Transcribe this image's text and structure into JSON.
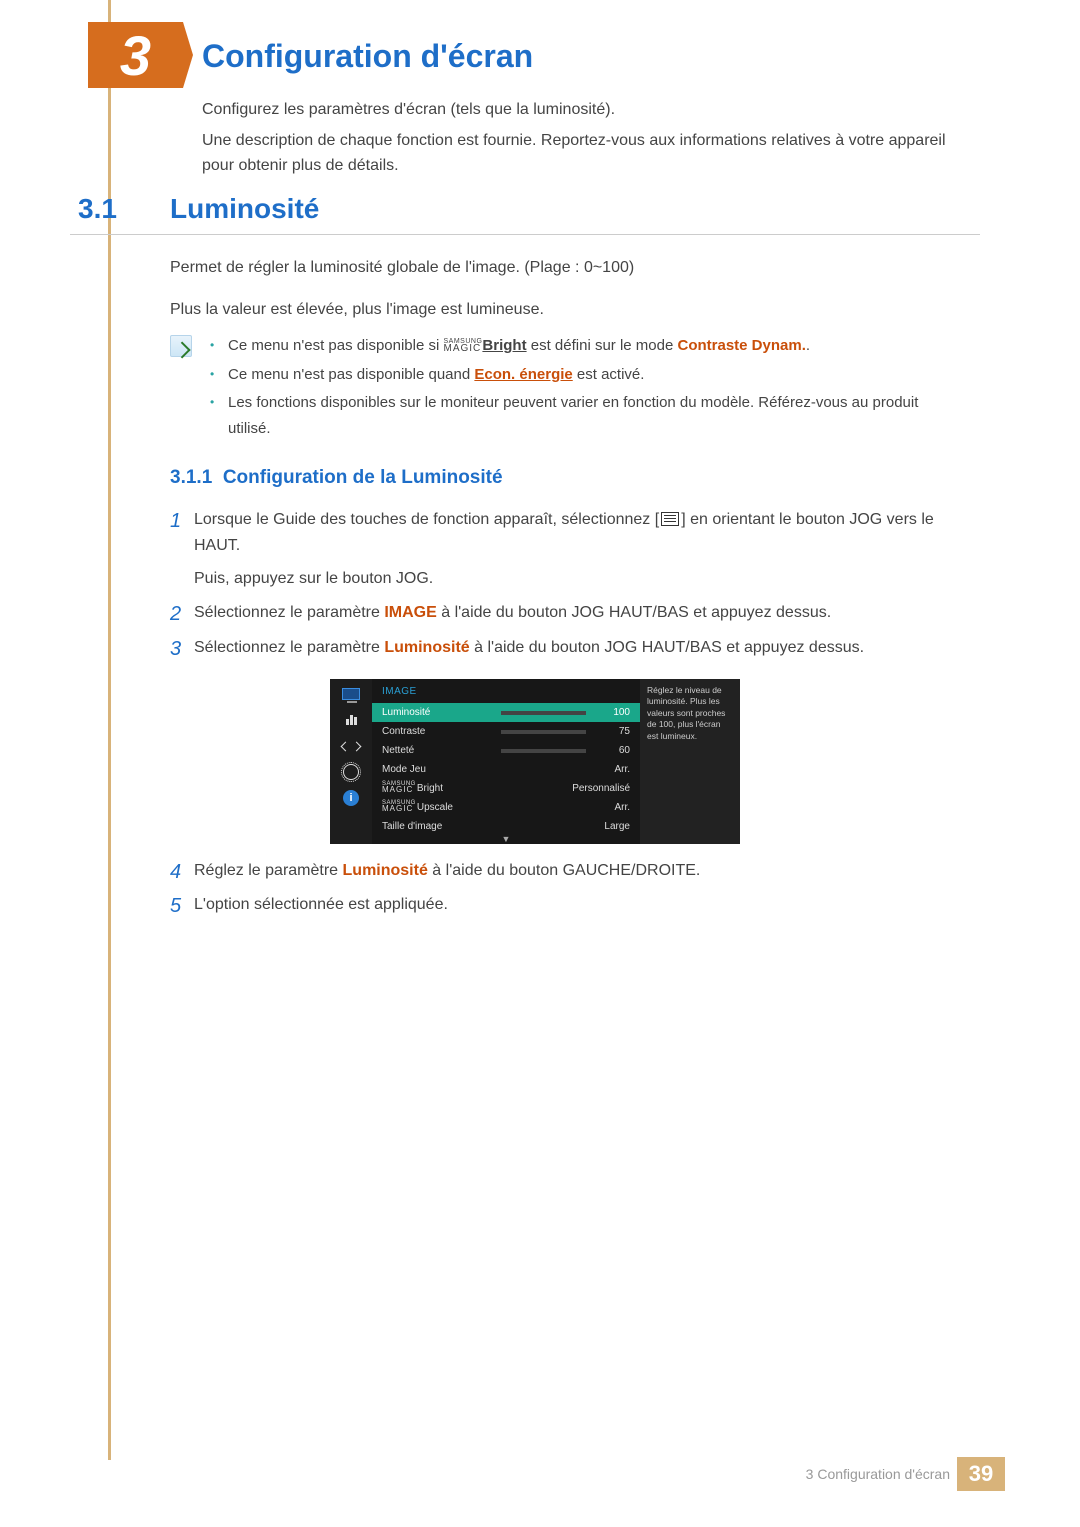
{
  "chapter": {
    "number": "3",
    "title": "Configuration d'écran"
  },
  "intro": {
    "p1": "Configurez les paramètres d'écran (tels que la luminosité).",
    "p2": "Une description de chaque fonction est fournie. Reportez-vous aux informations relatives à votre appareil pour obtenir plus de détails."
  },
  "section": {
    "num": "3.1",
    "title": "Luminosité"
  },
  "body": {
    "p1": "Permet de régler la luminosité globale de l'image. (Plage : 0~100)",
    "p2": "Plus la valeur est élevée, plus l'image est lumineuse."
  },
  "notes": {
    "n1_pre": "Ce menu n'est pas disponible si ",
    "n1_magic_top": "SAMSUNG",
    "n1_magic_bot": "MAGIC",
    "n1_bright": "Bright",
    "n1_mid": " est défini sur le mode ",
    "n1_mode": "Contraste Dynam.",
    "n1_end": ".",
    "n2_pre": "Ce menu n'est pas disponible quand ",
    "n2_link": "Econ. énergie",
    "n2_end": " est activé.",
    "n3": "Les fonctions disponibles sur le moniteur peuvent varier en fonction du modèle. Référez-vous au produit utilisé."
  },
  "subsection": {
    "num": "3.1.1",
    "title": "Configuration de la Luminosité"
  },
  "steps": {
    "s1a": "Lorsque le Guide des touches de fonction apparaît, sélectionnez [",
    "s1b": "] en orientant le bouton JOG vers le HAUT.",
    "s1c": "Puis, appuyez sur le bouton JOG.",
    "s2a": "Sélectionnez le paramètre ",
    "s2_hl": "IMAGE",
    "s2b": " à l'aide du bouton JOG HAUT/BAS et appuyez dessus.",
    "s3a": "Sélectionnez le paramètre ",
    "s3_hl": "Luminosité",
    "s3b": " à l'aide du bouton JOG HAUT/BAS et appuyez dessus.",
    "s4a": "Réglez le paramètre ",
    "s4_hl": "Luminosité",
    "s4b": " à l'aide du bouton GAUCHE/DROITE.",
    "s5": "L'option sélectionnée est appliquée."
  },
  "osd": {
    "header": "IMAGE",
    "samsung": "SAMSUNG",
    "magic": "MAGIC",
    "rows": [
      {
        "label": "Luminosité",
        "type": "bar",
        "value": 100,
        "fill": 100,
        "selected": true
      },
      {
        "label": "Contraste",
        "type": "bar",
        "value": 75,
        "fill": 75,
        "selected": false
      },
      {
        "label": "Netteté",
        "type": "bar",
        "value": 60,
        "fill": 60,
        "selected": false
      },
      {
        "label": "Mode Jeu",
        "type": "text",
        "value": "Arr.",
        "selected": false
      },
      {
        "label": "Bright",
        "type": "text",
        "value": "Personnalisé",
        "selected": false,
        "magic": true
      },
      {
        "label": "Upscale",
        "type": "text",
        "value": "Arr.",
        "selected": false,
        "magic": true
      },
      {
        "label": "Taille d'image",
        "type": "text",
        "value": "Large",
        "selected": false
      }
    ],
    "tooltip": "Réglez le niveau de luminosité. Plus les valeurs sont proches de 100, plus l'écran est lumineux."
  },
  "footer": {
    "text": "3 Configuration d'écran",
    "page": "39"
  }
}
